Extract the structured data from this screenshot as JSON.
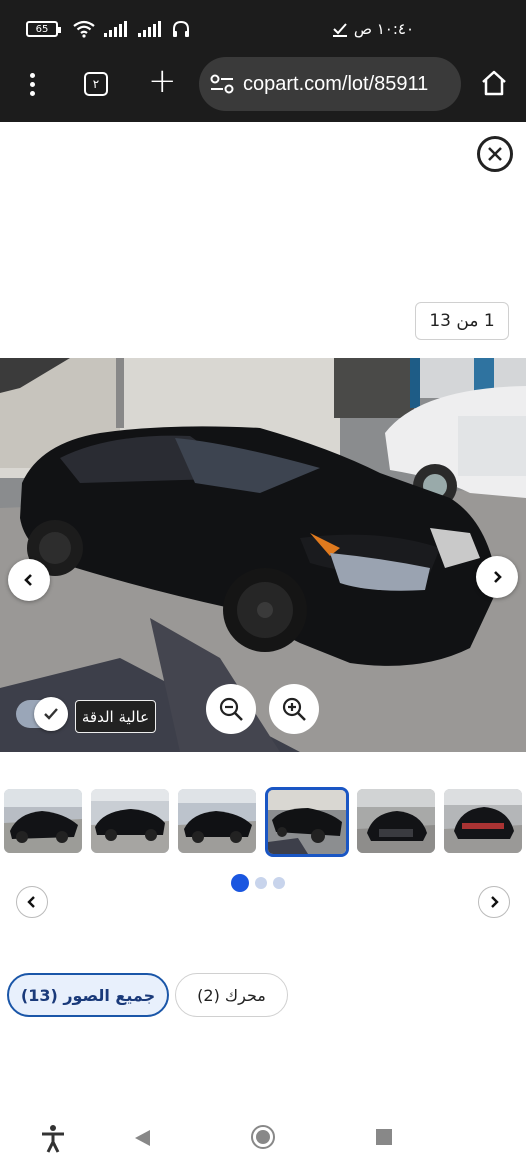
{
  "status_bar": {
    "battery": "65",
    "time": "١٠:٤٠ ص"
  },
  "browser": {
    "tab_count": "٢",
    "url": "copart.com/lot/85911"
  },
  "viewer": {
    "counter": "1 من 13",
    "hd_label": "عالية الدقة"
  },
  "thumbnails": {
    "count": 6,
    "active_index": 3,
    "pages": 3,
    "active_page": 0
  },
  "filters": {
    "all_photos": "جميع الصور (13)",
    "engine": "محرك (2)"
  },
  "colors": {
    "accent": "#1a56c4",
    "dark_bar": "#1c1c1c"
  }
}
